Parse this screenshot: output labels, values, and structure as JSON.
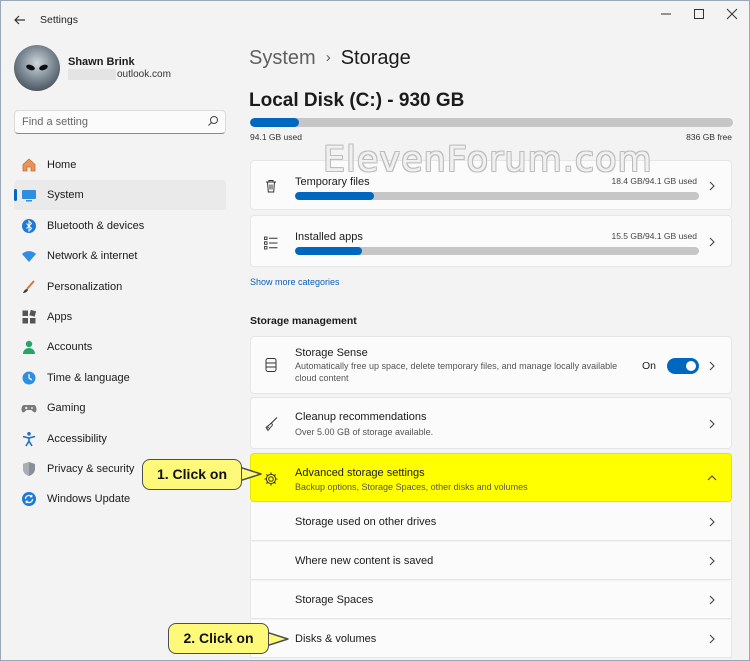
{
  "window": {
    "title": "Settings"
  },
  "profile": {
    "name": "Shawn Brink",
    "email": "outlook.com"
  },
  "search": {
    "placeholder": "Find a setting"
  },
  "nav": [
    {
      "label": "Home",
      "icon": "home-icon"
    },
    {
      "label": "System",
      "icon": "system-icon",
      "active": true
    },
    {
      "label": "Bluetooth & devices",
      "icon": "bluetooth-icon"
    },
    {
      "label": "Network & internet",
      "icon": "wifi-icon"
    },
    {
      "label": "Personalization",
      "icon": "brush-icon"
    },
    {
      "label": "Apps",
      "icon": "apps-icon"
    },
    {
      "label": "Accounts",
      "icon": "accounts-icon"
    },
    {
      "label": "Time & language",
      "icon": "clock-globe-icon"
    },
    {
      "label": "Gaming",
      "icon": "gamepad-icon"
    },
    {
      "label": "Accessibility",
      "icon": "accessibility-icon"
    },
    {
      "label": "Privacy & security",
      "icon": "shield-icon"
    },
    {
      "label": "Windows Update",
      "icon": "update-icon"
    }
  ],
  "breadcrumb": {
    "parent": "System",
    "current": "Storage"
  },
  "disk": {
    "title": "Local Disk (C:) - 930 GB",
    "used": "94.1 GB used",
    "free": "836 GB free",
    "used_fraction": 0.101
  },
  "categories": [
    {
      "title": "Temporary files",
      "size": "18.4 GB/94.1 GB used",
      "fraction": 0.196
    },
    {
      "title": "Installed apps",
      "size": "15.5 GB/94.1 GB used",
      "fraction": 0.165
    }
  ],
  "show_more": "Show more categories",
  "storage_management": {
    "heading": "Storage management",
    "storage_sense": {
      "title": "Storage Sense",
      "subtitle": "Automatically free up space, delete temporary files, and manage locally available cloud content",
      "toggle_label": "On"
    },
    "cleanup": {
      "title": "Cleanup recommendations",
      "subtitle": "Over 5.00 GB of storage available."
    },
    "advanced": {
      "title": "Advanced storage settings",
      "subtitle": "Backup options, Storage Spaces, other disks and volumes"
    },
    "sub_items": [
      "Storage used on other drives",
      "Where new content is saved",
      "Storage Spaces",
      "Disks & volumes"
    ]
  },
  "callouts": {
    "first": "1. Click on",
    "second": "2. Click on"
  },
  "watermark": "ElevenForum.com",
  "colors": {
    "accent": "#0067c0",
    "highlight": "#ffff00",
    "callout": "#fff97a"
  }
}
